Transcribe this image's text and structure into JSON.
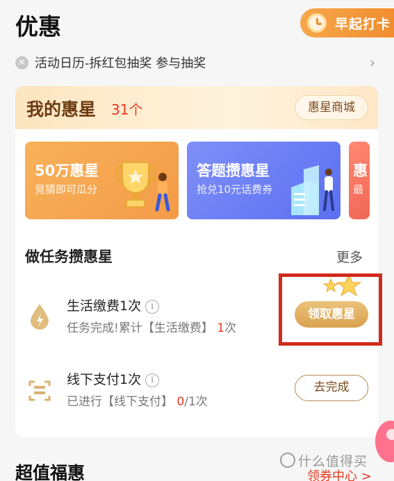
{
  "header": {
    "title": "优惠",
    "checkin_label": "早起打卡"
  },
  "notice": {
    "text": "活动日历-拆红包抽奖 参与抽奖",
    "close_icon": "close-icon",
    "arrow_icon": "chevron-right-icon"
  },
  "stars_card": {
    "title": "我的惠星",
    "count": "31个",
    "mall_label": "惠星商城",
    "banners": [
      {
        "title": "50万惠星",
        "subtitle": "竞猜即可瓜分"
      },
      {
        "title": "答题攒惠星",
        "subtitle": "抢兑10元话费券"
      },
      {
        "title": "惠",
        "subtitle": "最"
      }
    ],
    "tasks_title": "做任务攒惠星",
    "more_label": "更多",
    "tasks": [
      {
        "name": "生活缴费1次",
        "desc_prefix": "任务完成!累计【生活缴费】 ",
        "desc_done": "1",
        "desc_suffix": "次",
        "action": "领取惠星"
      },
      {
        "name": "线下支付1次",
        "desc_prefix": "已进行【线下支付】 ",
        "desc_done": "0",
        "desc_suffix": "/1次",
        "action": "去完成"
      }
    ]
  },
  "bottom": {
    "title": "超值福惠",
    "coupon_link": "领券中心 >",
    "watermark": "什么值得买"
  },
  "colors": {
    "accent_orange": "#f08a2c",
    "accent_red": "#e8391f",
    "gold": "#d9a14f",
    "highlight_box": "#d12a1e"
  }
}
